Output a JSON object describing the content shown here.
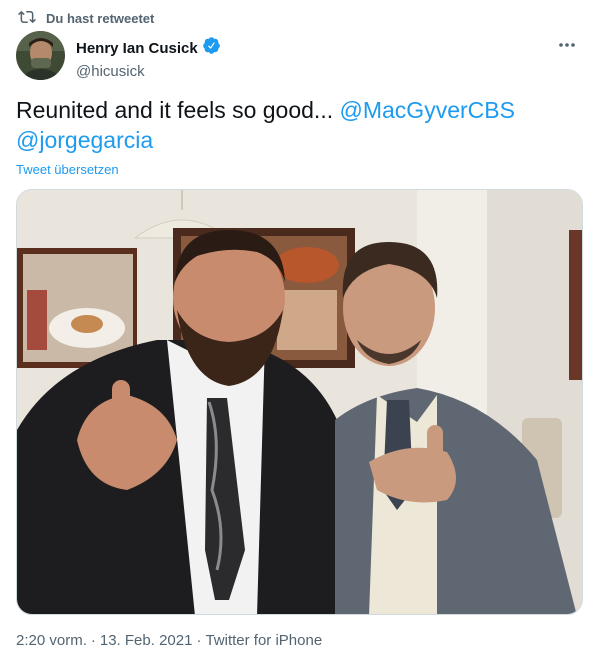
{
  "retweet": {
    "label": "Du hast retweetet",
    "icon": "retweet-icon"
  },
  "author": {
    "display_name": "Henry Ian Cusick",
    "handle": "@hicusick",
    "verified": true,
    "verified_color": "#1d9bf0"
  },
  "tweet": {
    "text_before": "Reunited and it feels so good... ",
    "mention_1": "@MacGyverCBS",
    "mention_2": "@jorgegarcia",
    "translate_label": "Tweet übersetzen"
  },
  "meta": {
    "time": "2:20 vorm.",
    "sep1": "·",
    "date": "13. Feb. 2021",
    "sep2": "·",
    "source": "Twitter for iPhone"
  },
  "colors": {
    "accent": "#1d9bf0",
    "secondary_text": "#536471",
    "text": "#0f1419"
  }
}
